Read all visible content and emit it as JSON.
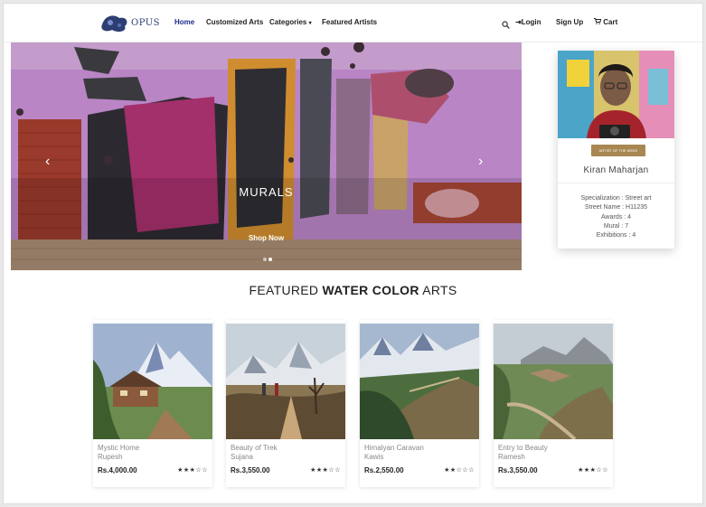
{
  "brand": {
    "name": "OPUS"
  },
  "nav": {
    "home": "Home",
    "customized": "Customized Arts",
    "categories": "Categories",
    "featured_artists": "Featured Artists",
    "login": "Login",
    "signup": "Sign Up",
    "cart": "Cart"
  },
  "hero": {
    "caption": "MURALS",
    "cta": "Shop Now"
  },
  "artist": {
    "badge": "ARTIST OF THE WEEK",
    "name": "Kiran Maharjan",
    "specialization": "Specialization : Street art",
    "street_name": "Street Name : H11235",
    "awards": "Awards : 4",
    "mural": "Mural : 7",
    "exhibitions": "Exhibitions : 4"
  },
  "section": {
    "title_pre": "FEATURED ",
    "title_bold": "WATER COLOR",
    "title_post": " ARTS"
  },
  "products": [
    {
      "title": "Mystic Home",
      "artist": "Rupesh",
      "price": "Rs.4,000.00",
      "rating": 3
    },
    {
      "title": "Beauty of Trek",
      "artist": "Sujana",
      "price": "Rs.3,550.00",
      "rating": 3
    },
    {
      "title": "Himalyan Caravan",
      "artist": "Kawis",
      "price": "Rs.2,550.00",
      "rating": 2
    },
    {
      "title": "Entry to Beauty",
      "artist": "Ramesh",
      "price": "Rs.3,550.00",
      "rating": 3
    }
  ],
  "colors": {
    "accent": "#1b2a8e",
    "badge": "#a88752",
    "wall": "#b87fc2"
  }
}
